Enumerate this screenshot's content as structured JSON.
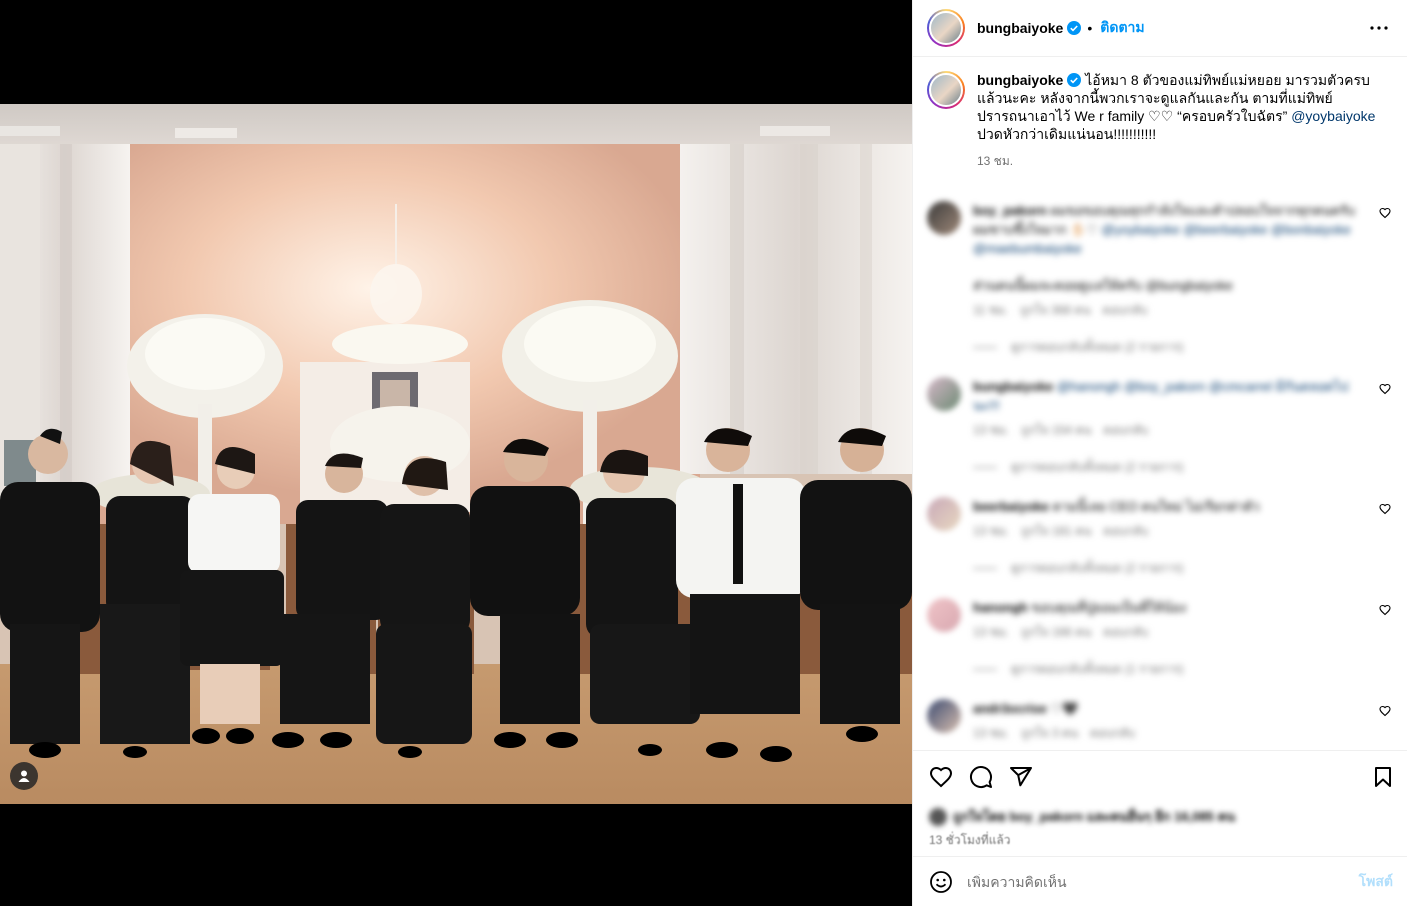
{
  "header": {
    "username": "bungbaiyoke",
    "separator": "•",
    "follow_label": "ติดตาม",
    "verified_icon": "verified-badge-icon",
    "more_icon": "more-options-icon"
  },
  "caption": {
    "username": "bungbaiyoke",
    "text_1": " ไอ้หมา 8 ตัวของแม่ทิพย์แม่หยอย มารวมตัวครบแล้วนะคะ หลังจากนี้พวกเราจะดูแลกันและกัน ตามที่แม่ทิพย์ปรารถนาเอาไว้ We r family ♡♡ “ครอบครัวใบฉัตร” ",
    "mention": "@yoybaiyoke",
    "text_2": " ปวดหัวกว่าเดิมแน่นอน!!!!!!!!!!!",
    "time": "13 ชม."
  },
  "comments": [
    {
      "username": "boy_pakorn",
      "text": "ผมขอขอบคุณทุกกำลังใจและคำปลอบใจจากทุกคนครับ ผมซาบซึ้งใจมาก ✋🏻♡",
      "mentions": "@yoybaiyoke @beerbaiyoke @bonbaiyoke @maebumbaiyoke",
      "text_extra": "ส่วนคนนี้ผมจะคอยดูแลให้ครับ @bungbaiyoke",
      "time": "11 ชม.",
      "likes": "ถูกใจ 368 คน",
      "reply": "ตอบกลับ",
      "view_replies": "ดูการตอบกลับทั้งหมด (2 รายการ)"
    },
    {
      "username": "bungbaiyoke",
      "text": "@hanongh @boy_pakorn @cmcarrel มีกันตลอดไปนะ!!!",
      "time": "13 ชม.",
      "likes": "ถูกใจ 154 คน",
      "reply": "ตอบกลับ",
      "view_replies": "ดูการตอบกลับทั้งหมด (2 รายการ)"
    },
    {
      "username": "beerbaiyoke",
      "text": "ตามนี้เลย CEO คนใหม่ ไม่เรียกค่าตัว",
      "time": "13 ชม.",
      "likes": "ถูกใจ 181 คน",
      "reply": "ตอบกลับ",
      "view_replies": "ดูการตอบกลับทั้งหมด (2 รายการ)"
    },
    {
      "username": "hanongh",
      "text": "ขอบคุณที่ปู่ยอมเป็นพี่ให้น้อง",
      "time": "13 ชม.",
      "likes": "ถูกใจ 166 คน",
      "reply": "ตอบกลับ",
      "view_replies": "ดูการตอบกลับทั้งหมด (1 รายการ)"
    },
    {
      "username": "andr3ocrise",
      "text": "♡🖤",
      "time": "13 ชม.",
      "likes": "ถูกใจ 3 คน",
      "reply": "ตอบกลับ"
    }
  ],
  "actions": {
    "like_icon": "heart-icon",
    "comment_icon": "comment-bubble-icon",
    "share_icon": "paper-plane-icon",
    "save_icon": "bookmark-icon"
  },
  "likes": {
    "text": "ถูกใจโดย boy_pakorn และคนอื่นๆ อีก 16,085 คน",
    "time": "13 ชั่วโมงที่แล้ว"
  },
  "add_comment": {
    "placeholder": "เพิ่มความคิดเห็น",
    "post_label": "โพสต์",
    "emoji_icon": "emoji-smiley-icon"
  },
  "colors": {
    "accent": "#0095f6",
    "verified": "#0095f6",
    "post_disabled": "#b2dffc",
    "secondary_text": "#737373",
    "mention": "#00376b"
  }
}
